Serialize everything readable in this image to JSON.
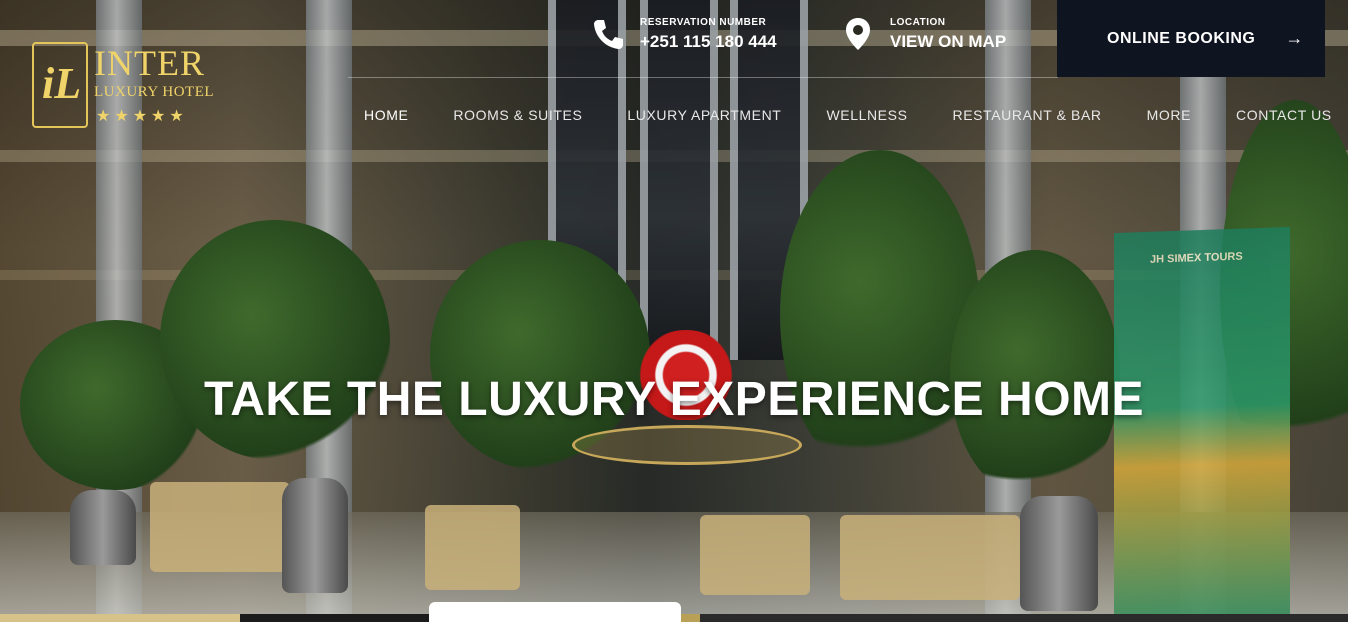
{
  "brand": {
    "monogram": "iL",
    "name": "INTER",
    "subtitle": "LUXURY HOTEL",
    "stars": "★★★★★"
  },
  "contacts": {
    "phone": {
      "label": "RESERVATION NUMBER",
      "value": "+251 115 180 444",
      "icon": "phone-icon"
    },
    "map": {
      "label": "LOCATION",
      "value": "VIEW ON MAP",
      "icon": "location-pin-icon"
    }
  },
  "booking": {
    "label": "ONLINE BOOKING",
    "arrow": "→"
  },
  "nav": {
    "items": [
      {
        "label": "HOME"
      },
      {
        "label": "ROOMS & SUITES"
      },
      {
        "label": "LUXURY APARTMENT"
      },
      {
        "label": "WELLNESS"
      },
      {
        "label": "RESTAURANT & BAR"
      },
      {
        "label": "MORE"
      },
      {
        "label": "CONTACT US"
      }
    ]
  },
  "hero": {
    "headline": "TAKE THE LUXURY EXPERIENCE HOME",
    "banner_text": "JH SIMEX TOURS"
  },
  "colors": {
    "gold": "#f0d46a",
    "booking_bg": "#0e1420",
    "text": "#ffffff"
  }
}
